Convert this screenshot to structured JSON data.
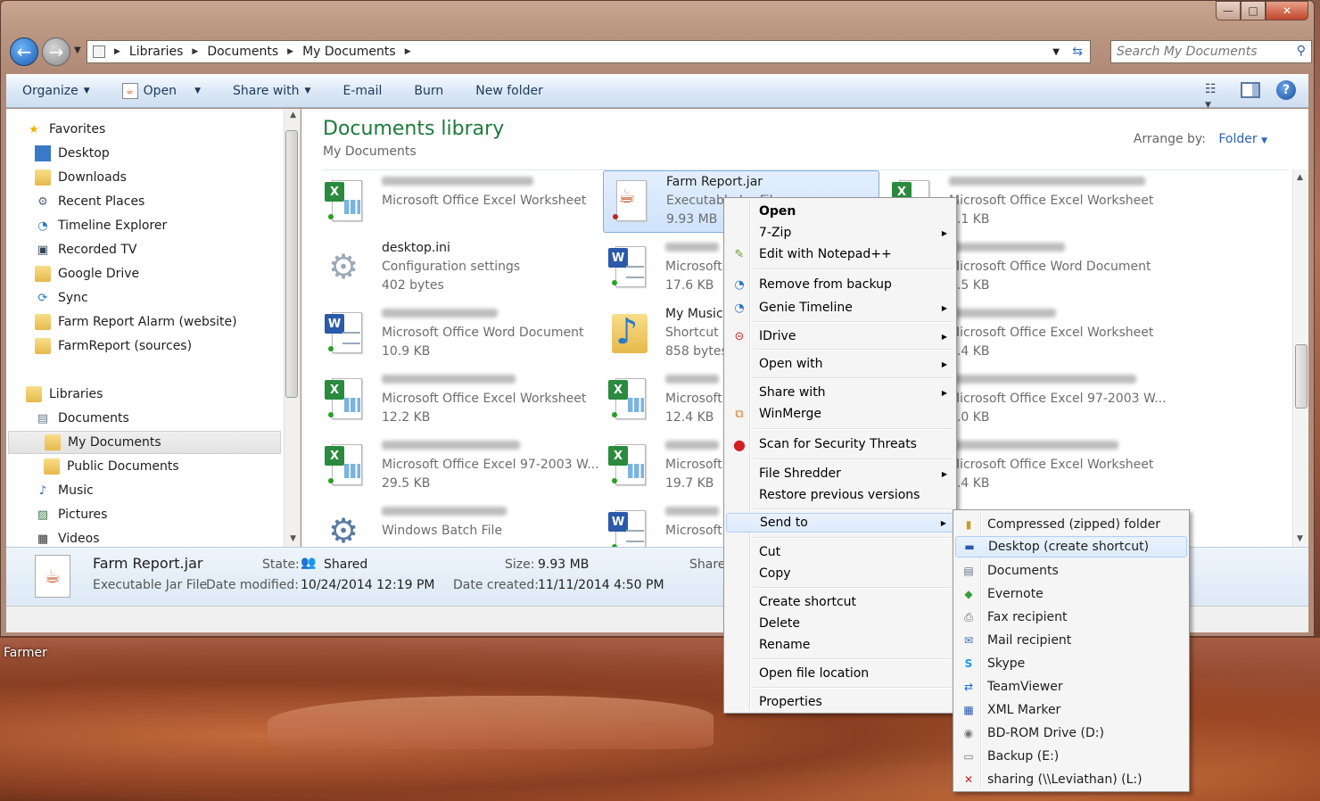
{
  "desktop": {
    "label": "Farmer"
  },
  "window": {
    "caption": {
      "minimize": "—",
      "maximize": "□",
      "close": "✕"
    }
  },
  "address": {
    "segments": [
      "Libraries",
      "Documents",
      "My Documents"
    ],
    "search_placeholder": "Search My Documents"
  },
  "toolbar": {
    "organize": "Organize",
    "open": "Open",
    "share_with": "Share with",
    "email": "E-mail",
    "burn": "Burn",
    "new_folder": "New folder"
  },
  "sidebar": {
    "favorites_header": "Favorites",
    "favorites": [
      {
        "label": "Desktop",
        "icon": "desktop-icon"
      },
      {
        "label": "Downloads",
        "icon": "folder-icon"
      },
      {
        "label": "Recent Places",
        "icon": "recent-places-icon"
      },
      {
        "label": "Timeline Explorer",
        "icon": "timeline-icon"
      },
      {
        "label": "Recorded TV",
        "icon": "tv-icon"
      },
      {
        "label": "Google Drive",
        "icon": "folder-icon"
      },
      {
        "label": "Sync",
        "icon": "sync-icon"
      },
      {
        "label": "Farm Report Alarm (website)",
        "icon": "folder-icon"
      },
      {
        "label": "FarmReport (sources)",
        "icon": "folder-icon"
      }
    ],
    "libraries_header": "Libraries",
    "libraries": [
      {
        "label": "Documents",
        "icon": "documents-icon"
      },
      {
        "label": "My Documents",
        "icon": "folder-icon",
        "selected": true
      },
      {
        "label": "Public Documents",
        "icon": "folder-icon"
      },
      {
        "label": "Music",
        "icon": "music-icon"
      },
      {
        "label": "Pictures",
        "icon": "pictures-icon"
      },
      {
        "label": "Videos",
        "icon": "videos-icon"
      }
    ]
  },
  "main": {
    "title": "Documents library",
    "subtitle": "My Documents",
    "arrange_label": "Arrange by:",
    "arrange_value": "Folder",
    "files": [
      {
        "name": "",
        "type": "Microsoft Office Excel Worksheet",
        "size": "",
        "icon": "excel-icon"
      },
      {
        "name": "desktop.ini",
        "type": "Configuration settings",
        "size": "402 bytes",
        "icon": "settings-file-icon"
      },
      {
        "name": "",
        "type": "Microsoft Office Word Document",
        "size": "10.9 KB",
        "icon": "word-icon"
      },
      {
        "name": "",
        "type": "Microsoft Office Excel Worksheet",
        "size": "12.2 KB",
        "icon": "excel-icon"
      },
      {
        "name": "",
        "type": "Microsoft Office Excel 97-2003 W...",
        "size": "29.5 KB",
        "icon": "excel-icon"
      },
      {
        "name": "",
        "type": "Windows Batch File",
        "size": "",
        "icon": "batch-file-icon"
      },
      {
        "name": "Farm Report.jar",
        "type": "Executable Jar File",
        "size": "9.93 MB",
        "icon": "jar-icon",
        "selected": true
      },
      {
        "name": "",
        "type": "Microsoft",
        "size": "17.6 KB",
        "icon": "word-icon"
      },
      {
        "name": "My Music",
        "type": "Shortcut",
        "size": "858 bytes",
        "icon": "music-folder-icon"
      },
      {
        "name": "",
        "type": "Microsoft",
        "size": "12.4 KB",
        "icon": "excel-icon"
      },
      {
        "name": "",
        "type": "Microsoft",
        "size": "19.7 KB",
        "icon": "excel-icon"
      },
      {
        "name": "",
        "type": "Microsoft",
        "size": "",
        "icon": "word-icon"
      },
      {
        "name": "",
        "type": "Microsoft Office Excel Worksheet",
        "size": "4.1 KB",
        "icon": "excel-icon"
      },
      {
        "name": "",
        "type": "Microsoft Office Word Document",
        "size": "1.5 KB",
        "icon": "word-icon"
      },
      {
        "name": "",
        "type": "Microsoft Office Excel Worksheet",
        "size": "8.4 KB",
        "icon": "excel-icon"
      },
      {
        "name": "",
        "type": "Microsoft Office Excel 97-2003 W...",
        "size": "1.0 KB",
        "icon": "excel-icon"
      },
      {
        "name": "",
        "type": "Microsoft Office Excel Worksheet",
        "size": "8.4 KB",
        "icon": "excel-icon"
      }
    ]
  },
  "details": {
    "name": "Farm Report.jar",
    "type": "Executable Jar File",
    "state_label": "State:",
    "state_value": "Shared",
    "modified_label": "Date modified:",
    "modified_value": "10/24/2014 12:19 PM",
    "size_label": "Size:",
    "size_value": "9.93 MB",
    "created_label": "Date created:",
    "created_value": "11/11/2014 4:50 PM",
    "share_label": "Share"
  },
  "context_menu": {
    "items": [
      {
        "label": "Open",
        "bold": true
      },
      {
        "label": "7-Zip",
        "submenu": true
      },
      {
        "label": "Edit with Notepad++",
        "icon": "notepad-plus-icon"
      },
      {
        "label": "Remove from backup",
        "icon": "backup-icon"
      },
      {
        "label": "Genie Timeline",
        "icon": "timeline-icon",
        "submenu": true
      },
      {
        "label": "IDrive",
        "icon": "idrive-icon",
        "submenu": true
      },
      {
        "label": "Open with",
        "submenu": true
      },
      {
        "label": "Share with",
        "submenu": true
      },
      {
        "label": "WinMerge",
        "icon": "winmerge-icon"
      },
      {
        "label": "Scan for Security Threats",
        "icon": "security-scan-icon"
      },
      {
        "label": "File Shredder",
        "submenu": true
      },
      {
        "label": "Restore previous versions"
      },
      {
        "label": "Send to",
        "submenu": true,
        "highlighted": true
      },
      {
        "label": "Cut"
      },
      {
        "label": "Copy"
      },
      {
        "label": "Create shortcut"
      },
      {
        "label": "Delete"
      },
      {
        "label": "Rename"
      },
      {
        "label": "Open file location"
      },
      {
        "label": "Properties"
      }
    ]
  },
  "send_to_menu": {
    "items": [
      {
        "label": "Compressed (zipped) folder",
        "icon": "zip-folder-icon"
      },
      {
        "label": "Desktop (create shortcut)",
        "icon": "desktop-icon",
        "highlighted": true
      },
      {
        "label": "Documents",
        "icon": "documents-icon"
      },
      {
        "label": "Evernote",
        "icon": "evernote-icon"
      },
      {
        "label": "Fax recipient",
        "icon": "fax-icon"
      },
      {
        "label": "Mail recipient",
        "icon": "mail-icon"
      },
      {
        "label": "Skype",
        "icon": "skype-icon"
      },
      {
        "label": "TeamViewer",
        "icon": "teamviewer-icon"
      },
      {
        "label": "XML Marker",
        "icon": "xml-marker-icon"
      },
      {
        "label": "BD-ROM Drive (D:)",
        "icon": "optical-drive-icon"
      },
      {
        "label": "Backup (E:)",
        "icon": "drive-icon"
      },
      {
        "label": "sharing (\\\\Leviathan) (L:)",
        "icon": "network-drive-icon"
      }
    ]
  }
}
